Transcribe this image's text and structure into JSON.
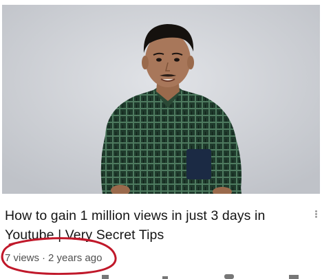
{
  "video": {
    "title": "How to gain 1 million views in just 3 days in Youtube | Very Secret Tips",
    "views": "7 views",
    "separator": "·",
    "age": "2 years ago"
  },
  "colors": {
    "annotation_circle": "#c0182a",
    "title_text": "#141414",
    "meta_text": "#505050",
    "thumbnail_bg": "#cfd1d6"
  },
  "icons": {
    "more": "vertical-dots-icon"
  }
}
